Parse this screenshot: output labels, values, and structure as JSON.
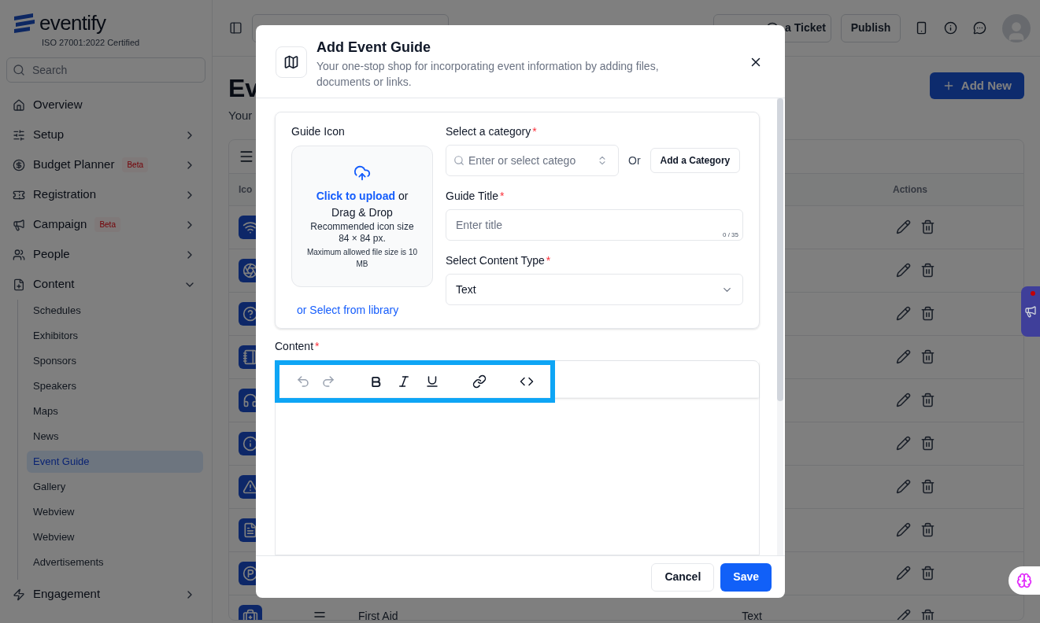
{
  "sidebar": {
    "logo": "eventify",
    "certification": "ISO 27001:2022 Certified",
    "search": {
      "placeholder": "Search"
    },
    "items": [
      {
        "label": "Overview"
      },
      {
        "label": "Setup",
        "expanded": false
      },
      {
        "label": "Budget Planner",
        "badge": "Beta",
        "expanded": false
      },
      {
        "label": "Registration",
        "expanded": false
      },
      {
        "label": "Campaign",
        "badge": "Beta",
        "expanded": false
      },
      {
        "label": "People",
        "expanded": false
      },
      {
        "label": "Content",
        "expanded": true,
        "children": [
          {
            "label": "Schedules",
            "selected": false
          },
          {
            "label": "Exhibitors",
            "selected": false
          },
          {
            "label": "Sponsors",
            "selected": false
          },
          {
            "label": "Speakers",
            "selected": false
          },
          {
            "label": "Maps",
            "selected": false
          },
          {
            "label": "News",
            "selected": false
          },
          {
            "label": "Event Guide",
            "selected": true
          },
          {
            "label": "Gallery",
            "selected": false
          },
          {
            "label": "Webview",
            "selected": false
          },
          {
            "label": "Webview",
            "selected": false
          },
          {
            "label": "Advertisements",
            "selected": false
          }
        ]
      },
      {
        "label": "Engagement",
        "expanded": false
      }
    ]
  },
  "topbar": {
    "ticket_button": "a Ticket",
    "publish_button": "Publish"
  },
  "page": {
    "title": "Ev",
    "subtitle": "Your",
    "add_button": "Add New",
    "table": {
      "columns": [
        "Ico",
        "Actions"
      ],
      "rows": [
        {},
        {},
        {},
        {},
        {},
        {},
        {},
        {},
        {},
        {
          "name": "First Aid",
          "type": "Text"
        }
      ]
    }
  },
  "modal": {
    "title": "Add Event Guide",
    "subtitle": "Your one-stop shop for incorporating event information by adding files, documents or links.",
    "guide_icon": {
      "label": "Guide Icon",
      "upload_link": "Click to upload",
      "upload_or": "or",
      "drag_drop": "Drag & Drop",
      "recommended": "Recommended icon size",
      "size": "84 × 84 px.",
      "max_size": "Maximum allowed file size is 10 MB",
      "library_link": "or Select from library"
    },
    "category": {
      "label": "Select a category",
      "required": true,
      "placeholder": "Enter or select catego",
      "or_text": "Or",
      "add_button": "Add a Category"
    },
    "guide_title": {
      "label": "Guide Title",
      "required": true,
      "placeholder": "Enter title",
      "counter": "0 / 35"
    },
    "content_type": {
      "label": "Select Content Type",
      "required": true,
      "value": "Text"
    },
    "content": {
      "label": "Content",
      "required": true,
      "toolbar_highlighted": true,
      "tools": [
        {
          "kind": "undo",
          "disabled": true
        },
        {
          "kind": "redo",
          "disabled": true
        },
        {
          "kind": "bold",
          "disabled": false
        },
        {
          "kind": "italic",
          "disabled": false
        },
        {
          "kind": "underline",
          "disabled": false
        },
        {
          "kind": "link",
          "disabled": false
        },
        {
          "kind": "code",
          "disabled": false
        }
      ]
    },
    "required_mark": "*",
    "cancel_button": "Cancel",
    "save_button": "Save"
  },
  "widgets": {
    "announcement_unread": true
  }
}
